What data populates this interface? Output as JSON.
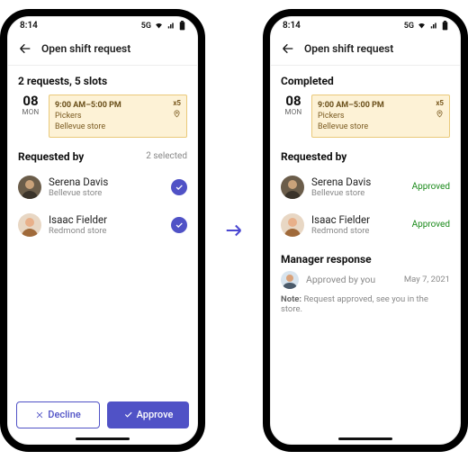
{
  "status": {
    "time": "8:14",
    "net": "5G"
  },
  "header": {
    "title": "Open shift request"
  },
  "left": {
    "summary": "2 requests, 5 slots",
    "date": {
      "day": "08",
      "dow": "MON"
    },
    "shift": {
      "time": "9:00 AM–5:00 PM",
      "role": "Pickers",
      "store": "Bellevue store",
      "multiplier": "x5"
    },
    "section": {
      "title": "Requested by",
      "selected": "2 selected"
    },
    "people": [
      {
        "name": "Serena Davis",
        "store": "Bellevue store"
      },
      {
        "name": "Isaac Fielder",
        "store": "Redmond store"
      }
    ],
    "buttons": {
      "decline": "Decline",
      "approve": "Approve"
    }
  },
  "right": {
    "summary": "Completed",
    "date": {
      "day": "08",
      "dow": "MON"
    },
    "shift": {
      "time": "9:00 AM–5:00 PM",
      "role": "Pickers",
      "store": "Bellevue store",
      "multiplier": "x5"
    },
    "section": {
      "title": "Requested by"
    },
    "people": [
      {
        "name": "Serena Davis",
        "store": "Bellevue store",
        "status": "Approved"
      },
      {
        "name": "Isaac Fielder",
        "store": "Redmond store",
        "status": "Approved"
      }
    ],
    "response": {
      "title": "Manager response",
      "text": "Approved by you",
      "date": "May 7, 2021",
      "note_label": "Note:",
      "note": "Request approved, see you in the store."
    }
  }
}
